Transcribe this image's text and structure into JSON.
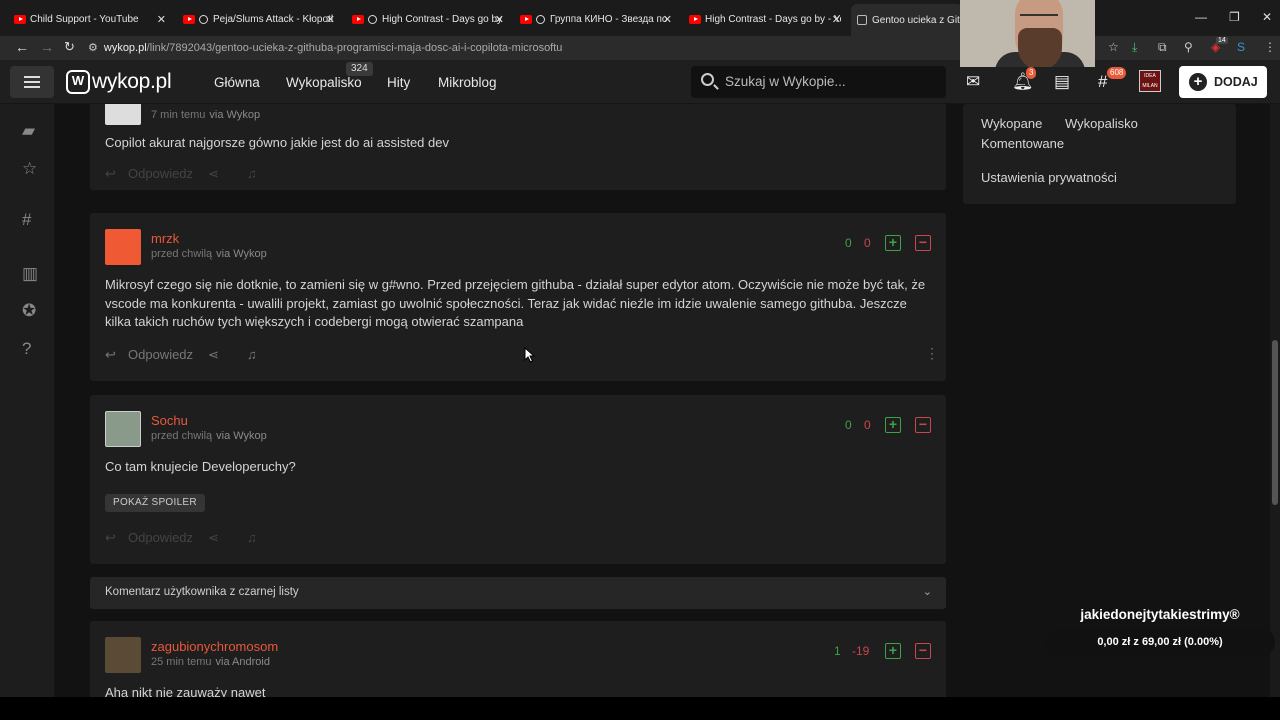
{
  "browser": {
    "tabs": [
      {
        "title": "Child Support - YouTube",
        "icon": "youtube-icon"
      },
      {
        "title": "Peja/Slums Attack - Kłopotl",
        "icon": "youtube-icon",
        "playing": true
      },
      {
        "title": "High Contrast - Days go by",
        "icon": "youtube-icon",
        "playing": true
      },
      {
        "title": "Группа КИНО - Звезда по",
        "icon": "youtube-icon",
        "playing": true
      },
      {
        "title": "High Contrast - Days go by - Yo",
        "icon": "youtube-icon"
      },
      {
        "title": "Gentoo ucieka z GitHu",
        "icon": "wykop-icon",
        "active": true
      }
    ],
    "url_host": "wykop.pl",
    "url_path": "/link/7892043/gentoo-ucieka-z-githuba-programisci-maja-dosc-ai-i-copilota-microsoftu",
    "ext_badge": "14"
  },
  "site": {
    "logo_text": "wykop.pl",
    "logo_letter": "W",
    "nav": [
      "Główna",
      "Wykopalisko",
      "Hity",
      "Mikroblog"
    ],
    "wykopalisko_count": "324",
    "search_placeholder": "Szukaj w Wykopie...",
    "notif_badge": "3",
    "tags_badge": "608",
    "avatar_text": "IDEA MILAN",
    "add_label": "DODAJ"
  },
  "sidebar_links": {
    "wykopane": "Wykopane",
    "wykopalisko": "Wykopalisko",
    "komentowane": "Komentowane",
    "privacy": "Ustawienia prywatności"
  },
  "comments": [
    {
      "author": "",
      "time": "7 min temu",
      "via": "via Wykop",
      "text": "Copilot akurat najgorsze gówno jakie jest do ai assisted dev",
      "reply": "Odpowiedz"
    },
    {
      "author": "mrzk",
      "time": "przed chwilą",
      "via": "via Wykop",
      "plus": "0",
      "minus": "0",
      "text": "Mikrosyf czego się nie dotknie, to zamieni się w g#wno. Przed przejęciem githuba - działał super edytor atom. Oczywiście nie może być tak, że vscode ma konkurenta - uwalili projekt, zamiast go uwolnić społeczności. Teraz jak widać nieźle im idzie uwalenie samego githuba. Jeszcze kilka takich ruchów tych większych i codebergi mogą otwierać szampana",
      "reply": "Odpowiedz"
    },
    {
      "author": "Sochu",
      "time": "przed chwilą",
      "via": "via Wykop",
      "plus": "0",
      "minus": "0",
      "text": "Co tam knujecie Developeruchy?",
      "spoiler": "POKAŻ SPOILER",
      "reply": "Odpowiedz"
    },
    {
      "author": "zagubionychromosom",
      "time": "25 min temu",
      "via": "via Android",
      "plus": "1",
      "minus": "-19",
      "text": "Aha nikt nie zauważy nawet"
    }
  ],
  "blacklist_text": "Komentarz użytkownika z czarnej listy",
  "donation": {
    "name": "jakiedonejtytakiestrimy®",
    "amount": "0,00 zł z 69,00 zł (0.00%)"
  },
  "colors": {
    "accent": "#e8583c",
    "plus": "#3ca24a",
    "minus": "#c8464d"
  }
}
